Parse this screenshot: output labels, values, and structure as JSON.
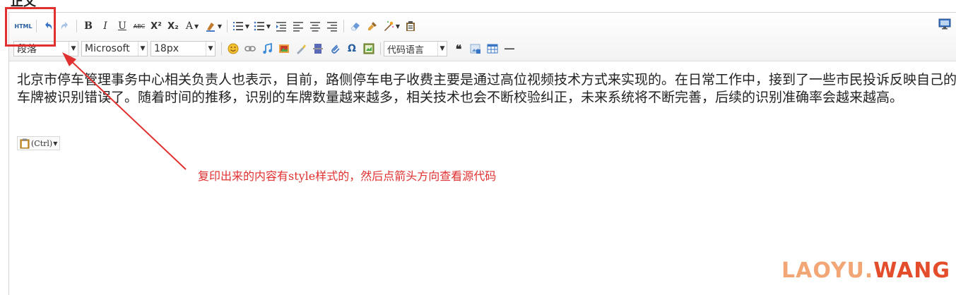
{
  "page": {
    "title": "正文"
  },
  "toolbar": {
    "html_label": "HTML",
    "bold": "B",
    "italic": "I",
    "underline": "U",
    "strikethrough": "ABC",
    "superscript": "X²",
    "subscript": "X₂",
    "font_color": "A",
    "paragraph_select": "段落",
    "font_select": "Microsoft",
    "size_select": "18px",
    "code_lang_select": "代码语言",
    "quote": "❝",
    "omega": "Ω"
  },
  "content": {
    "paragraph": "北京市停车管理事务中心相关负责人也表示，目前，路侧停车电子收费主要是通过高位视频技术方式来实现的。在日常工作中，接到了一些市民投诉反映自己的车牌被识别错误了。随着时间的推移，识别的车牌数量越来越多，相关技术也会不断校验纠正，未来系统将不断完善，后续的识别准确率会越来越高。",
    "paste_chip": "(Ctrl)"
  },
  "annotation": {
    "text": "复印出来的内容有style样式的，然后点箭头方向查看源代码"
  },
  "watermark": {
    "part1": "LAOYU.",
    "part2": "WANG"
  },
  "colors": {
    "annotation": "#e03030",
    "watermark_light": "#f2a676",
    "watermark_dark": "#e34d2b"
  }
}
